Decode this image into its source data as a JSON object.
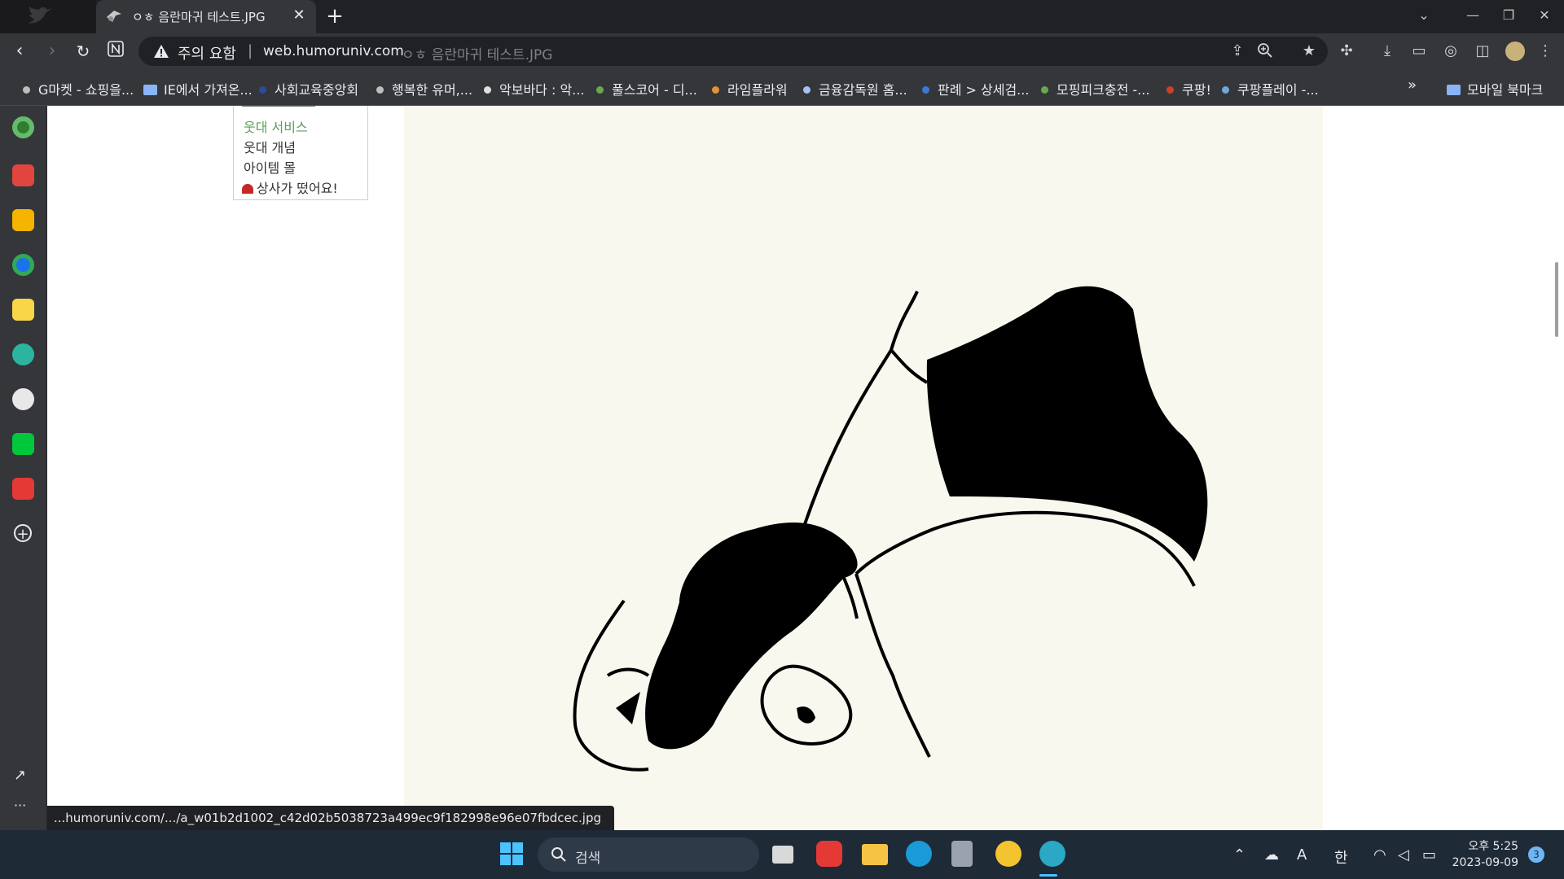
{
  "tab": {
    "title": "ㅇㅎ 음란마귀 테스트.JPG",
    "close": "✕",
    "new": "+"
  },
  "window": {
    "minimize": "—",
    "restore": "❐",
    "close": "✕",
    "tab_search": "⌄"
  },
  "address": {
    "warning": "주의 요함",
    "separator": "|",
    "host": "web.humoruniv.com",
    "path": "ㅇㅎ 음란마귀 테스트.JPG"
  },
  "bookmarks": [
    {
      "label": "G마켓 - 쇼핑을...",
      "color": "#bdbdbd"
    },
    {
      "label": "IE에서 가져온...",
      "folder": true
    },
    {
      "label": "사회교육중앙회",
      "color": "#2b4aa0"
    },
    {
      "label": "행복한 유머,...",
      "color": "#bdbdbd"
    },
    {
      "label": "악보바다 : 악...",
      "color": "#e0e0e0"
    },
    {
      "label": "풀스코어 - 디...",
      "color": "#6aa84f"
    },
    {
      "label": "라임플라워",
      "color": "#e69138"
    },
    {
      "label": "금융감독원 홈...",
      "color": "#a4c2f4"
    },
    {
      "label": "판례 > 상세검...",
      "color": "#3c78d8"
    },
    {
      "label": "모핑피크충전 -...",
      "color": "#6aa84f"
    },
    {
      "label": "쿠팡!",
      "color": "#cc4125"
    },
    {
      "label": "쿠팡플레이 -...",
      "color": "#6fa8dc"
    }
  ],
  "bookmarks_overflow": "»",
  "mobile_bookmarks": "모바일 북마크",
  "side_menu": {
    "items": [
      {
        "label": "웃대 서비스",
        "green": true
      },
      {
        "label": "웃대 개념"
      },
      {
        "label": "아이템 몰"
      },
      {
        "label": "상사가 떴어요!"
      }
    ]
  },
  "status_url": "...humoruniv.com/.../a_w01b2d1002_c42d02b5038723a499ec9f182998e96e07fbdcec.jpg",
  "taskbar": {
    "search_placeholder": "검색",
    "ime_a": "A",
    "ime_han": "한",
    "time": "오후 5:25",
    "date": "2023-09-09",
    "notification_count": "3"
  },
  "colors": {
    "chrome_dark": "#202124",
    "chrome_toolbar": "#35363a",
    "taskbar": "#1f2a37",
    "image_bg": "#f8f8ee"
  }
}
